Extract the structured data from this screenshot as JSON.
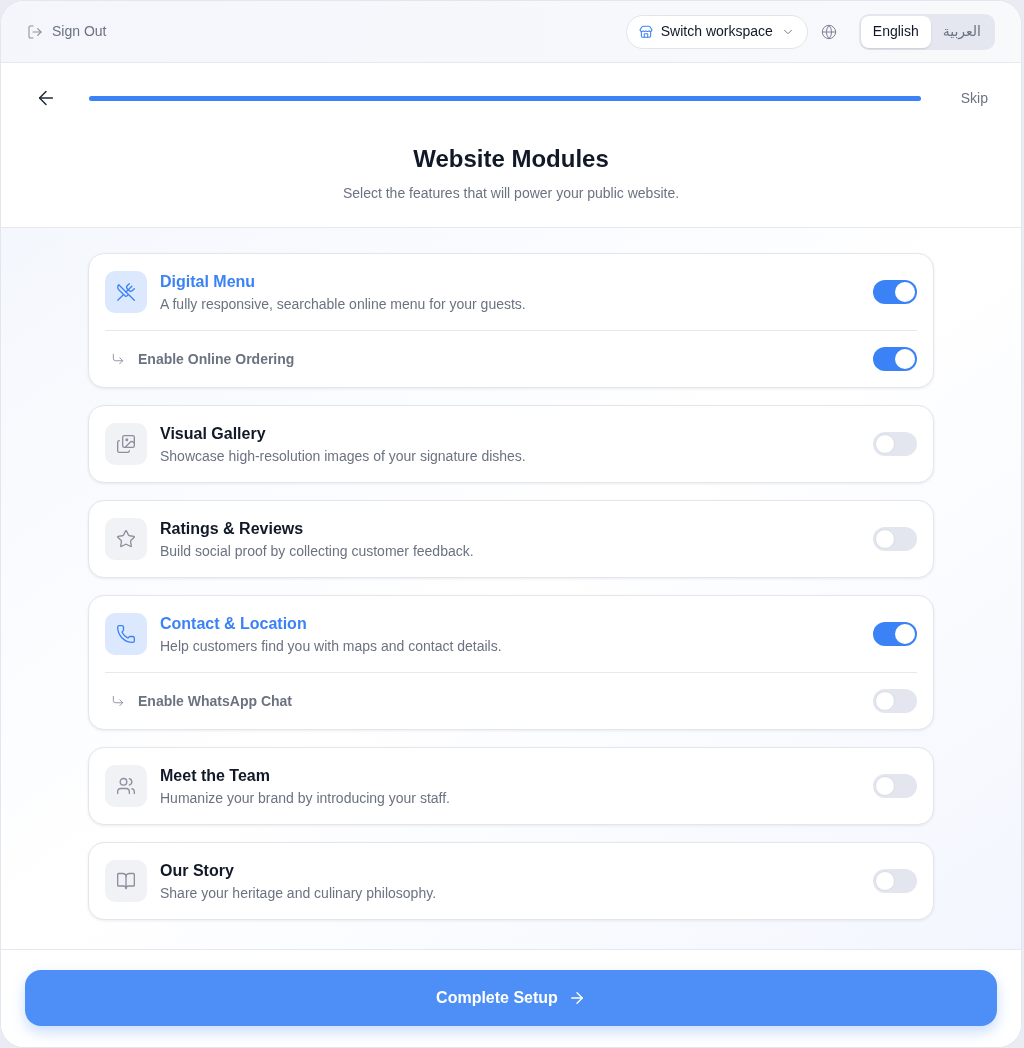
{
  "header": {
    "sign_out": "Sign Out",
    "workspace_button": "Switch workspace",
    "languages": [
      {
        "label": "English",
        "selected": true
      },
      {
        "label": "العربية",
        "selected": false
      }
    ]
  },
  "progress": {
    "level": 1,
    "skip": "Skip"
  },
  "title": "Website Modules",
  "subtitle": "Select the features that will power your public website.",
  "modules": [
    {
      "title": "Digital Menu",
      "description": "A fully responsive, searchable online menu for your guests.",
      "on": true,
      "sub_option": {
        "label": "Enable Online Ordering",
        "on": true
      }
    },
    {
      "title": "Visual Gallery",
      "description": "Showcase high-resolution images of your signature dishes.",
      "on": false
    },
    {
      "title": "Ratings & Reviews",
      "description": "Build social proof by collecting customer feedback.",
      "on": false
    },
    {
      "title": "Contact & Location",
      "description": "Help customers find you with maps and contact details.",
      "on": true,
      "sub_option": {
        "label": "Enable WhatsApp Chat",
        "on": false
      }
    },
    {
      "title": "Meet the Team",
      "description": "Humanize your brand by introducing your staff.",
      "on": false
    },
    {
      "title": "Our Story",
      "description": "Share your heritage and culinary philosophy.",
      "on": false
    }
  ],
  "footer": {
    "button": "Complete Setup"
  }
}
